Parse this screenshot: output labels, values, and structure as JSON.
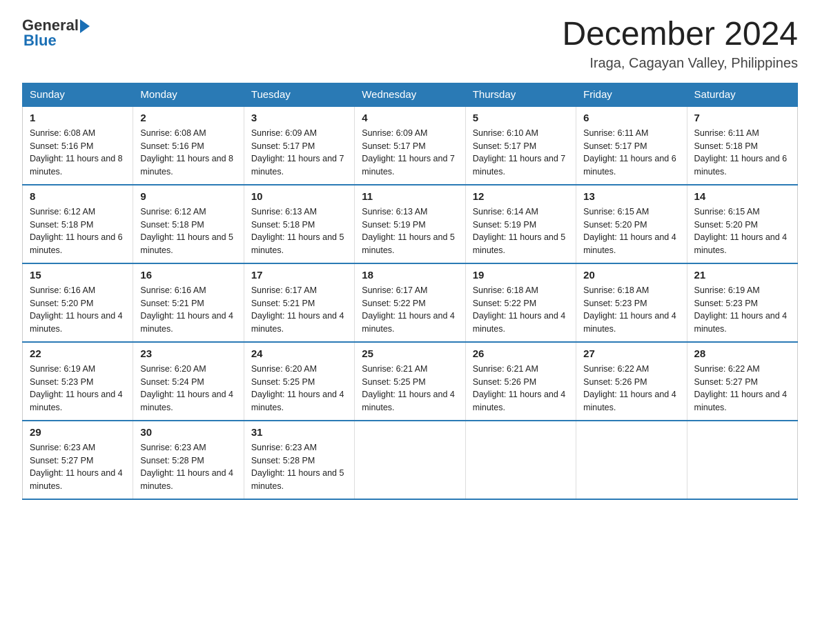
{
  "header": {
    "logo_general": "General",
    "logo_blue": "Blue",
    "title": "December 2024",
    "subtitle": "Iraga, Cagayan Valley, Philippines"
  },
  "columns": [
    "Sunday",
    "Monday",
    "Tuesday",
    "Wednesday",
    "Thursday",
    "Friday",
    "Saturday"
  ],
  "weeks": [
    [
      {
        "day": "1",
        "sunrise": "Sunrise: 6:08 AM",
        "sunset": "Sunset: 5:16 PM",
        "daylight": "Daylight: 11 hours and 8 minutes."
      },
      {
        "day": "2",
        "sunrise": "Sunrise: 6:08 AM",
        "sunset": "Sunset: 5:16 PM",
        "daylight": "Daylight: 11 hours and 8 minutes."
      },
      {
        "day": "3",
        "sunrise": "Sunrise: 6:09 AM",
        "sunset": "Sunset: 5:17 PM",
        "daylight": "Daylight: 11 hours and 7 minutes."
      },
      {
        "day": "4",
        "sunrise": "Sunrise: 6:09 AM",
        "sunset": "Sunset: 5:17 PM",
        "daylight": "Daylight: 11 hours and 7 minutes."
      },
      {
        "day": "5",
        "sunrise": "Sunrise: 6:10 AM",
        "sunset": "Sunset: 5:17 PM",
        "daylight": "Daylight: 11 hours and 7 minutes."
      },
      {
        "day": "6",
        "sunrise": "Sunrise: 6:11 AM",
        "sunset": "Sunset: 5:17 PM",
        "daylight": "Daylight: 11 hours and 6 minutes."
      },
      {
        "day": "7",
        "sunrise": "Sunrise: 6:11 AM",
        "sunset": "Sunset: 5:18 PM",
        "daylight": "Daylight: 11 hours and 6 minutes."
      }
    ],
    [
      {
        "day": "8",
        "sunrise": "Sunrise: 6:12 AM",
        "sunset": "Sunset: 5:18 PM",
        "daylight": "Daylight: 11 hours and 6 minutes."
      },
      {
        "day": "9",
        "sunrise": "Sunrise: 6:12 AM",
        "sunset": "Sunset: 5:18 PM",
        "daylight": "Daylight: 11 hours and 5 minutes."
      },
      {
        "day": "10",
        "sunrise": "Sunrise: 6:13 AM",
        "sunset": "Sunset: 5:18 PM",
        "daylight": "Daylight: 11 hours and 5 minutes."
      },
      {
        "day": "11",
        "sunrise": "Sunrise: 6:13 AM",
        "sunset": "Sunset: 5:19 PM",
        "daylight": "Daylight: 11 hours and 5 minutes."
      },
      {
        "day": "12",
        "sunrise": "Sunrise: 6:14 AM",
        "sunset": "Sunset: 5:19 PM",
        "daylight": "Daylight: 11 hours and 5 minutes."
      },
      {
        "day": "13",
        "sunrise": "Sunrise: 6:15 AM",
        "sunset": "Sunset: 5:20 PM",
        "daylight": "Daylight: 11 hours and 4 minutes."
      },
      {
        "day": "14",
        "sunrise": "Sunrise: 6:15 AM",
        "sunset": "Sunset: 5:20 PM",
        "daylight": "Daylight: 11 hours and 4 minutes."
      }
    ],
    [
      {
        "day": "15",
        "sunrise": "Sunrise: 6:16 AM",
        "sunset": "Sunset: 5:20 PM",
        "daylight": "Daylight: 11 hours and 4 minutes."
      },
      {
        "day": "16",
        "sunrise": "Sunrise: 6:16 AM",
        "sunset": "Sunset: 5:21 PM",
        "daylight": "Daylight: 11 hours and 4 minutes."
      },
      {
        "day": "17",
        "sunrise": "Sunrise: 6:17 AM",
        "sunset": "Sunset: 5:21 PM",
        "daylight": "Daylight: 11 hours and 4 minutes."
      },
      {
        "day": "18",
        "sunrise": "Sunrise: 6:17 AM",
        "sunset": "Sunset: 5:22 PM",
        "daylight": "Daylight: 11 hours and 4 minutes."
      },
      {
        "day": "19",
        "sunrise": "Sunrise: 6:18 AM",
        "sunset": "Sunset: 5:22 PM",
        "daylight": "Daylight: 11 hours and 4 minutes."
      },
      {
        "day": "20",
        "sunrise": "Sunrise: 6:18 AM",
        "sunset": "Sunset: 5:23 PM",
        "daylight": "Daylight: 11 hours and 4 minutes."
      },
      {
        "day": "21",
        "sunrise": "Sunrise: 6:19 AM",
        "sunset": "Sunset: 5:23 PM",
        "daylight": "Daylight: 11 hours and 4 minutes."
      }
    ],
    [
      {
        "day": "22",
        "sunrise": "Sunrise: 6:19 AM",
        "sunset": "Sunset: 5:23 PM",
        "daylight": "Daylight: 11 hours and 4 minutes."
      },
      {
        "day": "23",
        "sunrise": "Sunrise: 6:20 AM",
        "sunset": "Sunset: 5:24 PM",
        "daylight": "Daylight: 11 hours and 4 minutes."
      },
      {
        "day": "24",
        "sunrise": "Sunrise: 6:20 AM",
        "sunset": "Sunset: 5:25 PM",
        "daylight": "Daylight: 11 hours and 4 minutes."
      },
      {
        "day": "25",
        "sunrise": "Sunrise: 6:21 AM",
        "sunset": "Sunset: 5:25 PM",
        "daylight": "Daylight: 11 hours and 4 minutes."
      },
      {
        "day": "26",
        "sunrise": "Sunrise: 6:21 AM",
        "sunset": "Sunset: 5:26 PM",
        "daylight": "Daylight: 11 hours and 4 minutes."
      },
      {
        "day": "27",
        "sunrise": "Sunrise: 6:22 AM",
        "sunset": "Sunset: 5:26 PM",
        "daylight": "Daylight: 11 hours and 4 minutes."
      },
      {
        "day": "28",
        "sunrise": "Sunrise: 6:22 AM",
        "sunset": "Sunset: 5:27 PM",
        "daylight": "Daylight: 11 hours and 4 minutes."
      }
    ],
    [
      {
        "day": "29",
        "sunrise": "Sunrise: 6:23 AM",
        "sunset": "Sunset: 5:27 PM",
        "daylight": "Daylight: 11 hours and 4 minutes."
      },
      {
        "day": "30",
        "sunrise": "Sunrise: 6:23 AM",
        "sunset": "Sunset: 5:28 PM",
        "daylight": "Daylight: 11 hours and 4 minutes."
      },
      {
        "day": "31",
        "sunrise": "Sunrise: 6:23 AM",
        "sunset": "Sunset: 5:28 PM",
        "daylight": "Daylight: 11 hours and 5 minutes."
      },
      null,
      null,
      null,
      null
    ]
  ]
}
